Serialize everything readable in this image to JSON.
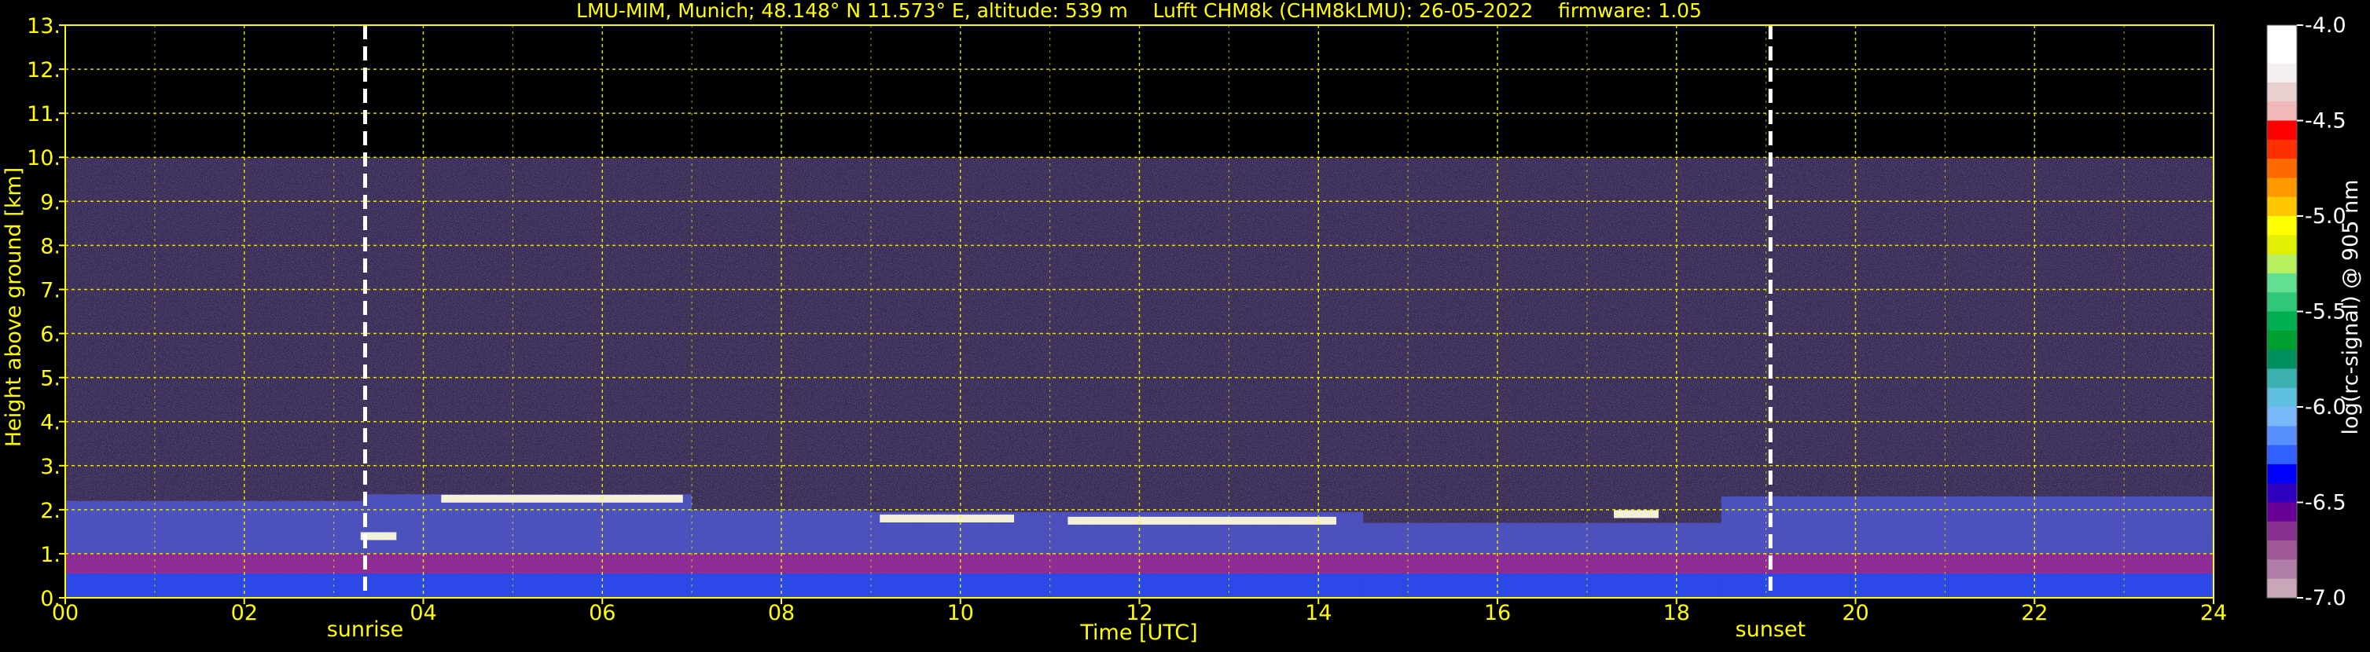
{
  "chart_data": {
    "type": "heatmap",
    "title": "LMU-MIM, Munich; 48.148° N 11.573° E, altitude: 539 m    Lufft CHM8k (CHM8kLMU): 26-05-2022    firmware: 1.05",
    "xlabel": "Time [UTC]",
    "ylabel": "Height above ground [km]",
    "xlim": [
      0,
      24
    ],
    "ylim": [
      0,
      13
    ],
    "x_ticks": [
      0,
      2,
      4,
      6,
      8,
      10,
      12,
      14,
      16,
      18,
      20,
      22,
      24
    ],
    "x_tick_labels": [
      "00",
      "02",
      "04",
      "06",
      "08",
      "10",
      "12",
      "14",
      "16",
      "18",
      "20",
      "22",
      "24"
    ],
    "y_ticks": [
      0,
      1,
      2,
      3,
      4,
      5,
      6,
      7,
      8,
      9,
      10,
      11,
      12,
      13
    ],
    "y_tick_labels": [
      "0.",
      "1.",
      "2.",
      "3.",
      "4.",
      "5.",
      "6.",
      "7.",
      "8.",
      "9.",
      "10.",
      "11.",
      "12.",
      "13."
    ],
    "grid": true,
    "data_top_km": 10,
    "markers": [
      {
        "label": "sunrise",
        "x": 3.35
      },
      {
        "label": "sunset",
        "x": 19.05
      }
    ],
    "colorbar": {
      "label": "log(rc-signal) @ 905 nm",
      "range": [
        -7.0,
        -4.0
      ],
      "tick_values": [
        -4.0,
        -4.5,
        -5.0,
        -5.5,
        -6.0,
        -6.5,
        -7.0
      ],
      "tick_labels": [
        "-4.0",
        "-4.5",
        "-5.0",
        "-5.5",
        "-6.0",
        "-6.5",
        "-7.0"
      ],
      "colors_top_to_bottom": [
        "#ffffff",
        "#ffffff",
        "#f4f0f0",
        "#e8d0d0",
        "#f0b8b8",
        "#ff0000",
        "#ff3000",
        "#ff6a00",
        "#ff9900",
        "#ffc800",
        "#ffff00",
        "#e0f000",
        "#b8f060",
        "#60e090",
        "#30c878",
        "#00b050",
        "#00a030",
        "#009060",
        "#3cb0b0",
        "#60c0e0",
        "#78b8f8",
        "#5890ff",
        "#3060ff",
        "#0000ff",
        "#3000c0",
        "#680098",
        "#883090",
        "#a05898",
        "#b07ca8",
        "#c8a8b8"
      ]
    },
    "boundary_layer": [
      {
        "x0": 0,
        "x1": 3.35,
        "h": 2.2
      },
      {
        "x0": 3.35,
        "x1": 7,
        "h": 2.35
      },
      {
        "x0": 7,
        "x1": 9,
        "h": 2.0
      },
      {
        "x0": 9,
        "x1": 14.5,
        "h": 1.95
      },
      {
        "x0": 14.5,
        "x1": 18.5,
        "h": 1.7
      },
      {
        "x0": 18.5,
        "x1": 24,
        "h": 2.3
      }
    ],
    "cloud_segments": [
      {
        "x0": 4.2,
        "x1": 6.9,
        "h": 2.25
      },
      {
        "x0": 9.1,
        "x1": 10.6,
        "h": 1.8
      },
      {
        "x0": 11.2,
        "x1": 14.2,
        "h": 1.75
      },
      {
        "x0": 17.3,
        "x1": 17.8,
        "h": 1.9
      },
      {
        "x0": 3.3,
        "x1": 3.7,
        "h": 1.4
      }
    ]
  },
  "colors": {
    "background": "#000000",
    "text": "#ffff00",
    "grid": "#ffff00",
    "marker": "#ffffff",
    "colorbar_text": "#ffffff"
  }
}
